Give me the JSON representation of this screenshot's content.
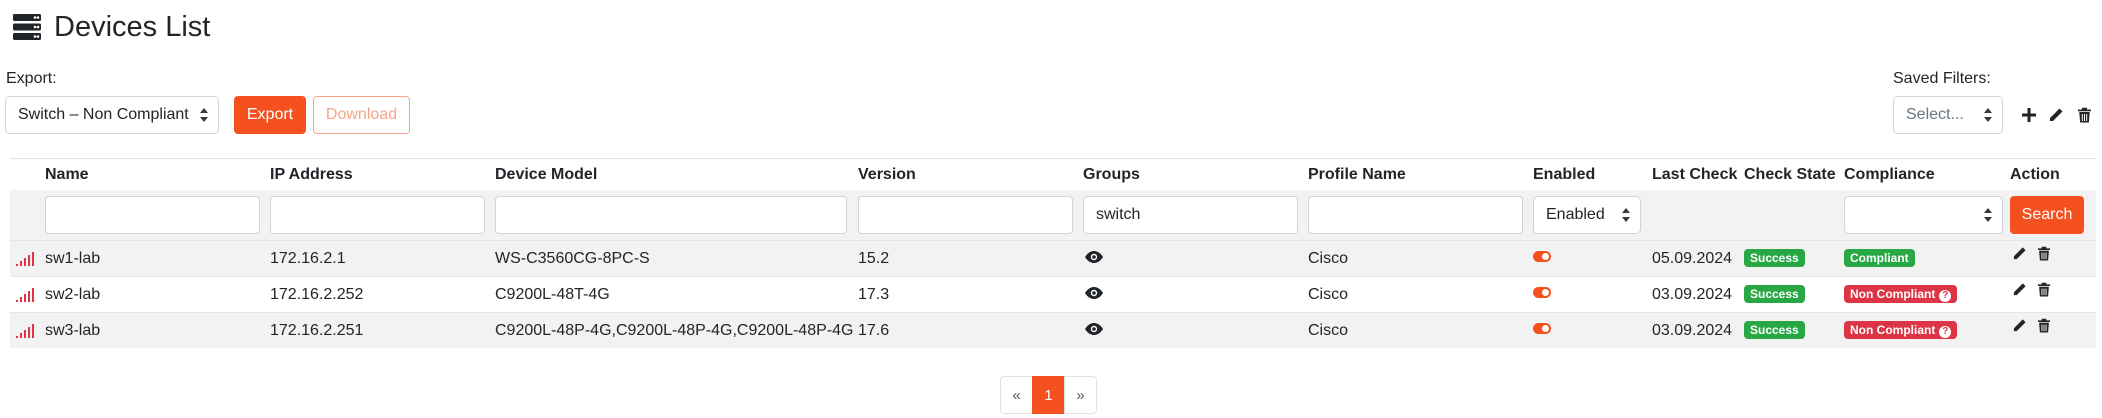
{
  "header": {
    "title": "Devices List",
    "icon": "server-icon"
  },
  "export": {
    "label": "Export:",
    "selected": "Switch – Non Compliant",
    "export_button": "Export",
    "download_button": "Download"
  },
  "saved_filters": {
    "label": "Saved Filters:",
    "selected": "Select..."
  },
  "table": {
    "columns": [
      "Name",
      "IP Address",
      "Device Model",
      "Version",
      "Groups",
      "Profile Name",
      "Enabled",
      "Last Check",
      "Check State",
      "Compliance",
      "Action"
    ],
    "filters": {
      "name": "",
      "ip": "",
      "model": "",
      "version": "",
      "groups": "switch",
      "profile": "",
      "enabled": "Enabled",
      "compliance": ""
    },
    "search_button": "Search",
    "rows": [
      {
        "name": "sw1-lab",
        "ip": "172.16.2.1",
        "model": "WS-C3560CG-8PC-S",
        "version": "15.2",
        "profile": "Cisco",
        "last_check": "05.09.2024",
        "check_state": "Success",
        "compliance": "Compliant"
      },
      {
        "name": "sw2-lab",
        "ip": "172.16.2.252",
        "model": "C9200L-48T-4G",
        "version": "17.3",
        "profile": "Cisco",
        "last_check": "03.09.2024",
        "check_state": "Success",
        "compliance": "Non Compliant"
      },
      {
        "name": "sw3-lab",
        "ip": "172.16.2.251",
        "model": "C9200L-48P-4G,C9200L-48P-4G,C9200L-48P-4G",
        "version": "17.6",
        "profile": "Cisco",
        "last_check": "03.09.2024",
        "check_state": "Success",
        "compliance": "Non Compliant"
      }
    ]
  },
  "pagination": {
    "prev": "«",
    "current": "1",
    "next": "»"
  },
  "colors": {
    "accent": "#f4511e",
    "success": "#28a745",
    "danger": "#dc3545"
  }
}
